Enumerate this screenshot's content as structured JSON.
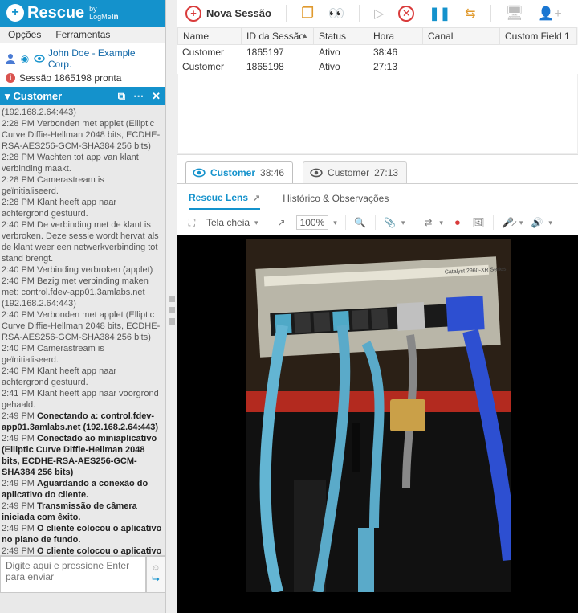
{
  "brand": {
    "product": "Rescue",
    "by": "by",
    "company_line1": "LogMe",
    "company_line2_bold": "In"
  },
  "menu": {
    "options": "Opções",
    "tools": "Ferramentas"
  },
  "tree": {
    "user": "John Doe - Example Corp.",
    "status": "Sessão 1865198 pronta"
  },
  "panel": {
    "title": "Customer",
    "address": "(192.168.2.64:443)"
  },
  "log_lines": [
    {
      "t": "2:28 PM",
      "m": "Verbonden met applet (Elliptic Curve Diffie-Hellman 2048 bits, ECDHE-RSA-AES256-GCM-SHA384 256 bits)",
      "b": false
    },
    {
      "t": "2:28 PM",
      "m": "Wachten tot app van klant verbinding maakt.",
      "b": false
    },
    {
      "t": "2:28 PM",
      "m": "Camerastream is geïnitialiseerd.",
      "b": false
    },
    {
      "t": "2:28 PM",
      "m": "Klant heeft app naar achtergrond gestuurd.",
      "b": false
    },
    {
      "t": "2:40 PM",
      "m": "De verbinding met de klant is verbroken. Deze sessie wordt hervat als de klant weer een netwerkverbinding tot stand brengt.",
      "b": false
    },
    {
      "t": "2:40 PM",
      "m": "Verbinding verbroken (applet)",
      "b": false
    },
    {
      "t": "2:40 PM",
      "m": "Bezig met verbinding maken met: control.fdev-app01.3amlabs.net (192.168.2.64:443)",
      "b": false
    },
    {
      "t": "2:40 PM",
      "m": "Verbonden met applet (Elliptic Curve Diffie-Hellman 2048 bits, ECDHE-RSA-AES256-GCM-SHA384 256 bits)",
      "b": false
    },
    {
      "t": "2:40 PM",
      "m": "Camerastream is geïnitialiseerd.",
      "b": false
    },
    {
      "t": "2:40 PM",
      "m": "Klant heeft app naar achtergrond gestuurd.",
      "b": false
    },
    {
      "t": "2:41 PM",
      "m": "Klant heeft app naar voorgrond gehaald.",
      "b": false
    },
    {
      "t": "2:49 PM",
      "m": "Conectando a: control.fdev-app01.3amlabs.net (192.168.2.64:443)",
      "b": true
    },
    {
      "t": "2:49 PM",
      "m": "Conectado ao miniaplicativo (Elliptic Curve Diffie-Hellman 2048 bits, ECDHE-RSA-AES256-GCM-SHA384 256 bits)",
      "b": true
    },
    {
      "t": "2:49 PM",
      "m": "Aguardando a conexão do aplicativo do cliente.",
      "b": true
    },
    {
      "t": "2:49 PM",
      "m": "Transmissão de câmera iniciada com êxito.",
      "b": true
    },
    {
      "t": "2:49 PM",
      "m": "O cliente colocou o aplicativo no plano de fundo.",
      "b": true
    },
    {
      "t": "2:49 PM",
      "m": "O cliente colocou o aplicativo em primeiro plano.",
      "b": true
    }
  ],
  "chat": {
    "placeholder": "Digite aqui e pressione Enter para enviar"
  },
  "toolbar": {
    "new_session": "Nova Sessão"
  },
  "table": {
    "headers": {
      "name": "Name",
      "id": "ID da Sessão",
      "status": "Status",
      "time": "Hora",
      "channel": "Canal",
      "custom1": "Custom Field 1"
    },
    "rows": [
      {
        "name": "Customer",
        "id": "1865197",
        "status": "Ativo",
        "time": "38:46",
        "channel": "",
        "custom1": ""
      },
      {
        "name": "Customer",
        "id": "1865198",
        "status": "Ativo",
        "time": "27:13",
        "channel": "",
        "custom1": ""
      }
    ]
  },
  "ctabs": [
    {
      "label": "Customer",
      "time": "38:46",
      "active": true
    },
    {
      "label": "Customer",
      "time": "27:13",
      "active": false
    }
  ],
  "subtabs": {
    "lens": "Rescue Lens",
    "history": "Histórico & Observações"
  },
  "viewer": {
    "fullscreen": "Tela cheia",
    "zoom": "100%"
  }
}
